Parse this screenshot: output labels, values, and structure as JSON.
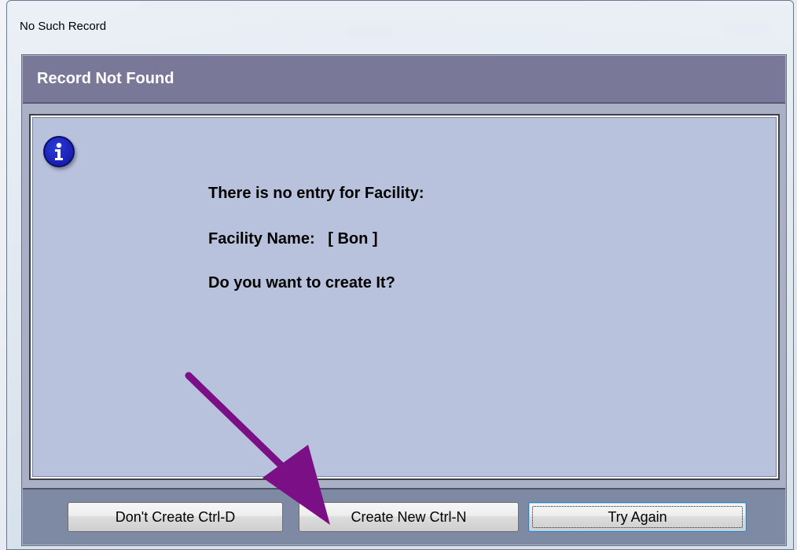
{
  "window": {
    "title": "No Such Record"
  },
  "header": {
    "title": "Record Not Found"
  },
  "message": {
    "icon": "info-icon",
    "line1": "There is no entry for Facility:",
    "line2": "Facility Name:   [ Bon ]",
    "line3": "Do you want to create It?"
  },
  "buttons": {
    "dont_create": "Don't Create Ctrl-D",
    "create_new": "Create New Ctrl-N",
    "try_again": "Try Again"
  },
  "annotation": {
    "arrow_color": "#7b0f86"
  },
  "colors": {
    "header_band": "#7a7899",
    "panel": "#b8c2dd",
    "button_bar": "#7e8aa4"
  }
}
